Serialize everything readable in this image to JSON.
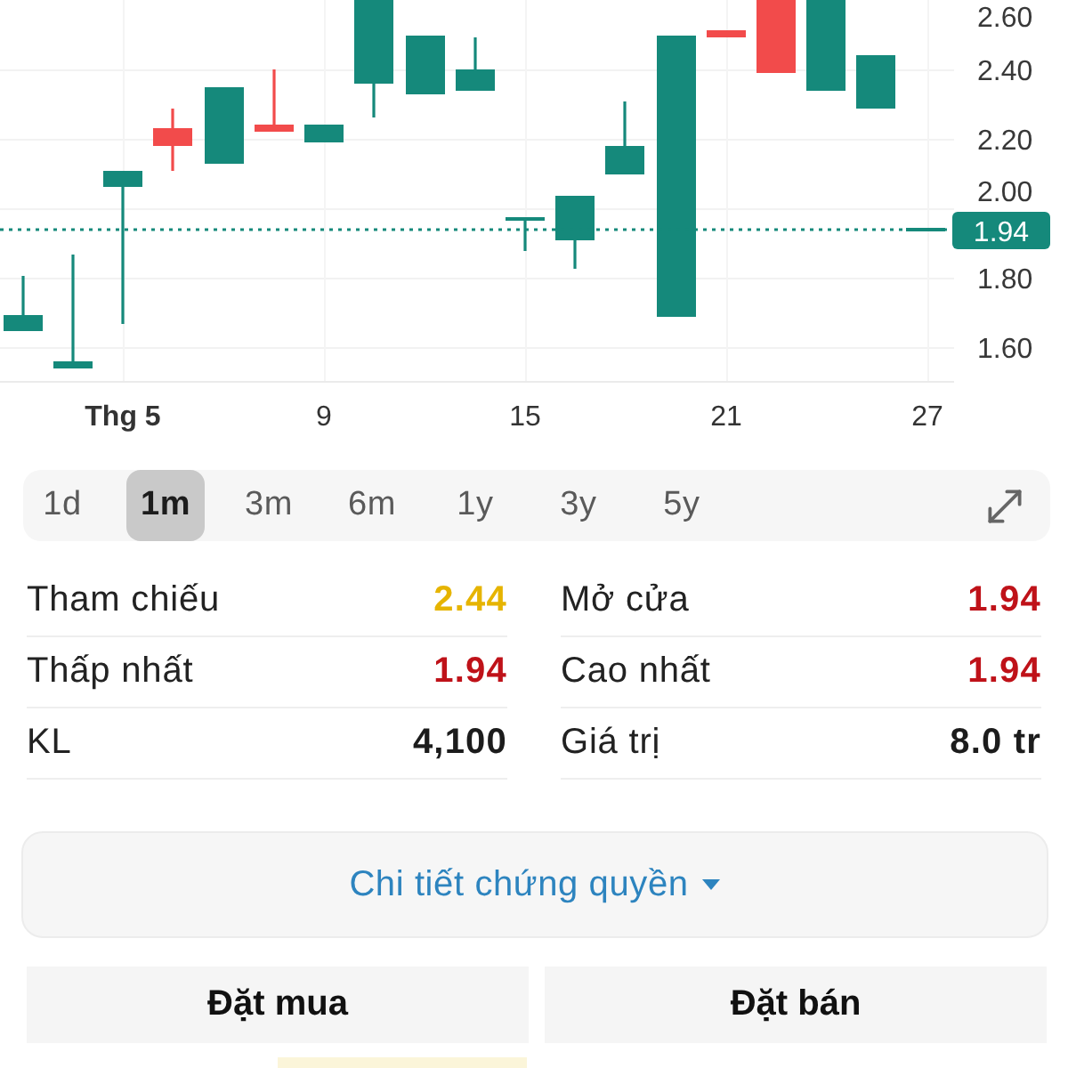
{
  "chart": {
    "y_ticks": [
      "2.60",
      "2.40",
      "2.20",
      "2.00",
      "1.80",
      "1.60"
    ],
    "x_labels": [
      {
        "text": "Thg 5",
        "kind": "month"
      },
      {
        "text": "9",
        "kind": "day"
      },
      {
        "text": "15",
        "kind": "day"
      },
      {
        "text": "21",
        "kind": "day"
      },
      {
        "text": "27",
        "kind": "day"
      }
    ],
    "last_price": "1.94"
  },
  "periods": [
    {
      "label": "1d",
      "selected": false
    },
    {
      "label": "1m",
      "selected": true
    },
    {
      "label": "3m",
      "selected": false
    },
    {
      "label": "6m",
      "selected": false
    },
    {
      "label": "1y",
      "selected": false
    },
    {
      "label": "3y",
      "selected": false
    },
    {
      "label": "5y",
      "selected": false
    }
  ],
  "stats": [
    {
      "label": "Tham chiếu",
      "value": "2.44",
      "color": "#e6b400"
    },
    {
      "label": "Mở cửa",
      "value": "1.94",
      "color": "#bf1219"
    },
    {
      "label": "Thấp nhất",
      "value": "1.94",
      "color": "#bf1219"
    },
    {
      "label": "Cao nhất",
      "value": "1.94",
      "color": "#bf1219"
    },
    {
      "label": "KL",
      "value": "4,100",
      "color": "#1c1c1c"
    },
    {
      "label": "Giá trị",
      "value": "8.0 tr",
      "color": "#1c1c1c"
    }
  ],
  "details_button": {
    "label": "Chi tiết chứng quyền"
  },
  "actions": [
    {
      "label": "Đặt mua"
    },
    {
      "label": "Đặt bán"
    }
  ]
}
